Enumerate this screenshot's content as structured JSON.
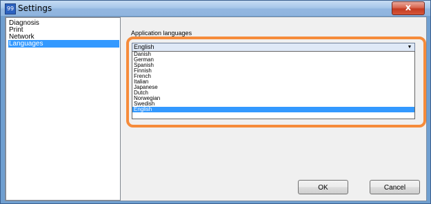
{
  "window": {
    "title": "Settings",
    "app_icon": "settings-app-icon",
    "close_symbol": "x"
  },
  "sidebar": {
    "items": [
      {
        "label": "Diagnosis",
        "selected": false
      },
      {
        "label": "Print",
        "selected": false
      },
      {
        "label": "Network",
        "selected": false
      },
      {
        "label": "Languages",
        "selected": true
      }
    ]
  },
  "languages": {
    "label": "Application languages",
    "selected_value": "English",
    "options": [
      "Danish",
      "German",
      "Spanish",
      "Finnish",
      "French",
      "Italian",
      "Japanese",
      "Dutch",
      "Norwegian",
      "Swedish",
      "English"
    ],
    "highlight_color": "#f68b3a"
  },
  "buttons": {
    "ok_label": "OK",
    "cancel_label": "Cancel"
  },
  "colors": {
    "selection": "#3399ff",
    "window_frame": "#6f9fd0",
    "close_button": "#c43b21"
  }
}
